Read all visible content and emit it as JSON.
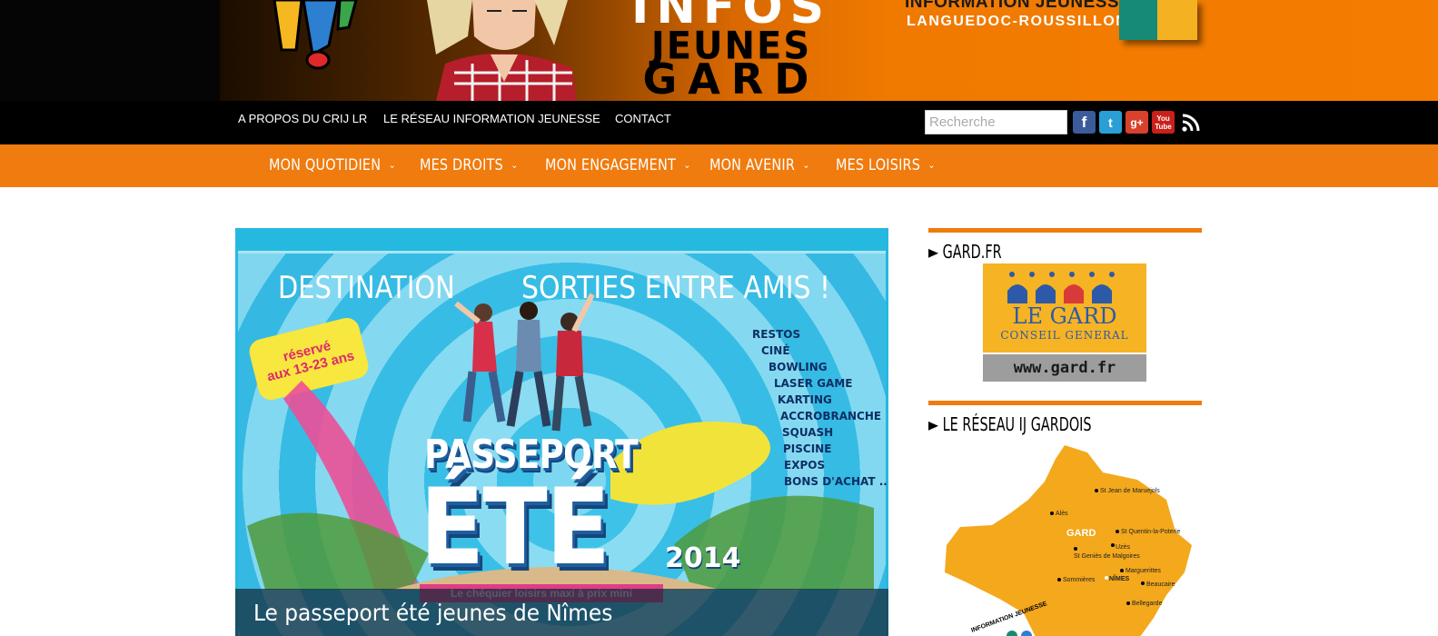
{
  "banner": {
    "title_line1": "INFOS",
    "title_line2": "JEUNES",
    "title_line3": "GARD",
    "network_line1": "INFORMATION JEUNESSE",
    "network_line2": "LANGUEDOC-ROUSSILLON"
  },
  "topnav": {
    "links": [
      "A PROPOS DU CRIJ LR",
      "LE RÉSEAU INFORMATION JEUNESSE",
      "CONTACT"
    ],
    "search_placeholder": "Recherche",
    "social": {
      "facebook": "f",
      "twitter": "t",
      "googleplus": "g+",
      "youtube_1": "You",
      "youtube_2": "Tube"
    }
  },
  "catnav": {
    "items": [
      "MON QUOTIDIEN",
      "MES DROITS",
      "MON ENGAGEMENT",
      "MON AVENIR",
      "MES LOISIRS"
    ],
    "chevron": "⌄"
  },
  "slider": {
    "headline_left": "DESTINATION",
    "headline_right": "SORTIES ENTRE AMIS !",
    "sticker_line1": "réservé",
    "sticker_line2": "aux 13-23 ans",
    "activities": [
      "RESTOS",
      "CINÉ",
      "BOWLING",
      "LASER GAME",
      "KARTING",
      "ACCROBRANCHE",
      "SQUASH",
      "PISCINE",
      "EXPOS",
      "BONS D'ACHAT ..."
    ],
    "passeport": "PASSEPORT",
    "ete": "ÉTÉ",
    "year": "2014",
    "cheque": "Le chéquier loisirs maxi à prix mini",
    "caption": "Le passeport été jeunes de Nîmes"
  },
  "sidebar": {
    "widget1_title": "► GARD.FR",
    "gard_name": "LE GARD",
    "gard_sub": "CONSEIL GENERAL",
    "gard_url": "www.gard.fr",
    "widget2_title": "► LE RÉSEAU IJ GARDOIS",
    "map_region": "GARD",
    "map_towns": [
      "St Jean de Maruejols",
      "Alès",
      "St Quentin-la-Poterie",
      "Uzès",
      "St Geniès de Malgoires",
      "Marguerittes",
      "Sommières",
      "NÎMES",
      "Beaucaire",
      "Bellegarde"
    ],
    "map_badge": "INFORMATION JEUNESSE"
  },
  "colors": {
    "orange": "#f07b0e",
    "black": "#000000",
    "sky": "#25b9df",
    "gard_yellow": "#f6b324"
  }
}
